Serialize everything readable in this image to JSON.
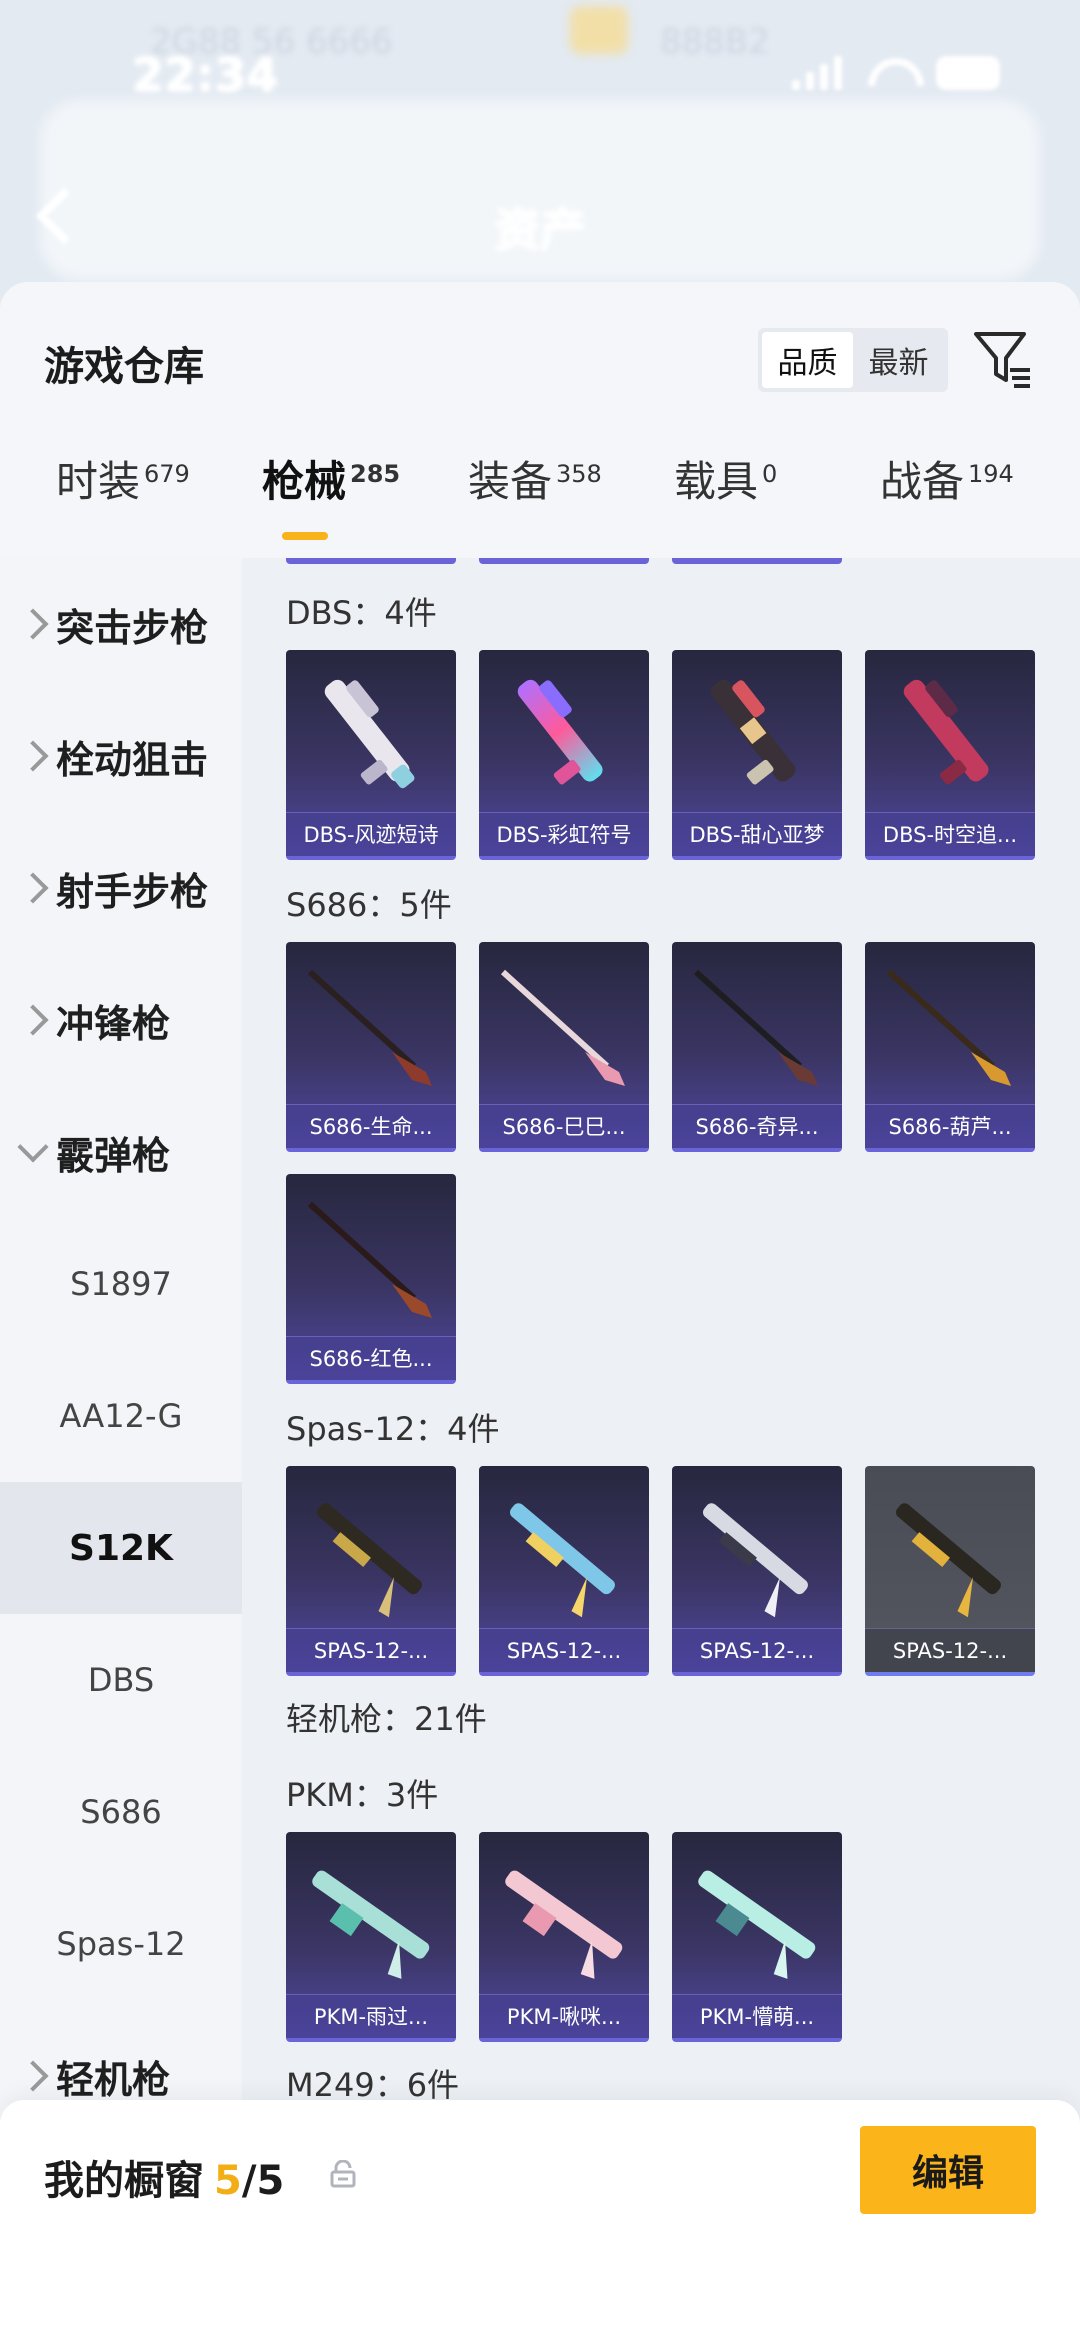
{
  "status_bar": {
    "time": "22:34",
    "ghost_left": "2G88 56 6666",
    "ghost_right": "888B2"
  },
  "header": {
    "title": "资产"
  },
  "panel": {
    "title": "游戏仓库",
    "sort": {
      "option_quality": "品质",
      "option_newest": "最新",
      "selected": "最新"
    }
  },
  "tabs": [
    {
      "label": "时装",
      "count": "679"
    },
    {
      "label": "枪械",
      "count": "285",
      "active": true
    },
    {
      "label": "装备",
      "count": "358"
    },
    {
      "label": "载具",
      "count": "0"
    },
    {
      "label": "战备",
      "count": "194"
    }
  ],
  "sidebar": {
    "categories": [
      "突击步枪",
      "栓动狙击",
      "射手步枪",
      "冲锋枪",
      "霰弹枪",
      "轻机枪"
    ],
    "expanded": "霰弹枪",
    "subitems": [
      "S1897",
      "AA12-G",
      "S12K",
      "DBS",
      "S686",
      "Spas-12"
    ],
    "selected": "S12K"
  },
  "groups": {
    "dbs": {
      "label": "DBS：4件",
      "items": [
        "DBS-风迹短诗",
        "DBS-彩虹符号",
        "DBS-甜心亚梦",
        "DBS-时空追..."
      ]
    },
    "s686": {
      "label": "S686：5件",
      "items": [
        "S686-生命...",
        "S686-巳巳...",
        "S686-奇异...",
        "S686-葫芦...",
        "S686-红色..."
      ]
    },
    "spas": {
      "label": "Spas-12：4件",
      "items": [
        "SPAS-12-...",
        "SPAS-12-...",
        "SPAS-12-...",
        "SPAS-12-..."
      ]
    },
    "lmg": {
      "label": "轻机枪：21件"
    },
    "pkm": {
      "label": "PKM：3件",
      "items": [
        "PKM-雨过...",
        "PKM-啾咪...",
        "PKM-懵萌..."
      ]
    },
    "m249": {
      "label": "M249：6件"
    }
  },
  "bottom": {
    "title": "我的橱窗",
    "count": "5",
    "total": "/5",
    "edit": "编辑"
  },
  "colors": {
    "accent": "#fbb51b",
    "card_bottom": "#6b63d8",
    "panel_bg": "#eef1f6"
  }
}
